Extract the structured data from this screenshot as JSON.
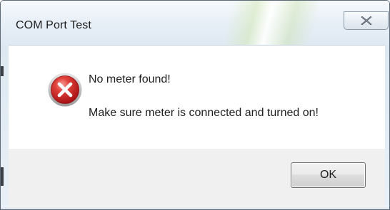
{
  "window": {
    "title": "COM Port Test"
  },
  "titlebar": {
    "close_icon": "close-x-icon"
  },
  "message": {
    "icon": "error-icon",
    "line1": "No meter found!",
    "line2": "Make sure meter is connected and turned on!"
  },
  "buttons": {
    "ok_label": "OK"
  },
  "colors": {
    "error_red": "#c8181c",
    "footer_bg": "#f0f0f0",
    "content_bg": "#ffffff"
  }
}
